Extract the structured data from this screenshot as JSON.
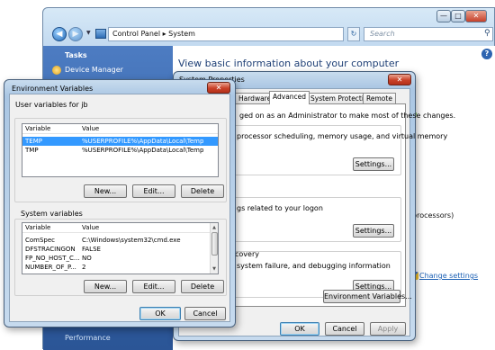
{
  "control_panel": {
    "address": "Control Panel ▸ System",
    "search_placeholder": "Search",
    "sidebar_heading": "Tasks",
    "sidebar_item": "Device Manager",
    "sidebar_footer": "Performance",
    "main_heading": "View basic information about your computer",
    "processors_text": "processors)",
    "change_settings": "Change settings"
  },
  "system_properties": {
    "title": "System Properties",
    "tabs": [
      "Hardware",
      "Advanced",
      "System Protection",
      "Remote"
    ],
    "active_tab": "Advanced",
    "admin_note": "ged on as an Administrator to make most of these changes.",
    "performance_text": "processor scheduling, memory usage, and virtual memory",
    "profiles_text": "gs related to your logon",
    "recovery_heading": "covery",
    "recovery_text": "system failure, and debugging information",
    "settings_label": "Settings...",
    "env_button": "Environment Variables...",
    "ok": "OK",
    "cancel": "Cancel",
    "apply": "Apply"
  },
  "environment_variables": {
    "title": "Environment Variables",
    "user_group_label": "User variables for jb",
    "system_group_label": "System variables",
    "col_variable": "Variable",
    "col_value": "Value",
    "user_rows": [
      {
        "variable": "TEMP",
        "value": "%USERPROFILE%\\AppData\\Local\\Temp"
      },
      {
        "variable": "TMP",
        "value": "%USERPROFILE%\\AppData\\Local\\Temp"
      }
    ],
    "system_rows": [
      {
        "variable": "ComSpec",
        "value": "C:\\Windows\\system32\\cmd.exe"
      },
      {
        "variable": "DFSTRACINGON",
        "value": "FALSE"
      },
      {
        "variable": "FP_NO_HOST_C...",
        "value": "NO"
      },
      {
        "variable": "NUMBER_OF_P...",
        "value": "2"
      }
    ],
    "new_label": "New...",
    "edit_label": "Edit...",
    "delete_label": "Delete",
    "ok": "OK",
    "cancel": "Cancel"
  },
  "colors": {
    "selection": "#3399ff",
    "sidebar": "#2f5fa5",
    "link": "#1a5fb4"
  }
}
